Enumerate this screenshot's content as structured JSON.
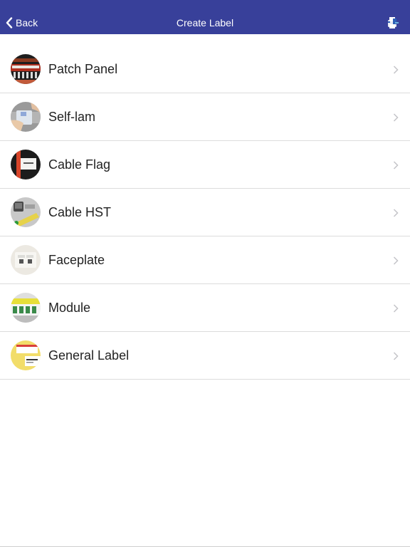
{
  "navbar": {
    "back_label": "Back",
    "title": "Create Label",
    "back_icon": "chevron-left-icon",
    "right_icon": "printer-icon",
    "background": "#38409a"
  },
  "items": [
    {
      "label": "Patch Panel",
      "icon": "patch-panel-thumbnail"
    },
    {
      "label": "Self-lam",
      "icon": "self-lam-thumbnail"
    },
    {
      "label": "Cable Flag",
      "icon": "cable-flag-thumbnail"
    },
    {
      "label": "Cable HST",
      "icon": "cable-hst-thumbnail"
    },
    {
      "label": "Faceplate",
      "icon": "faceplate-thumbnail"
    },
    {
      "label": "Module",
      "icon": "module-thumbnail"
    },
    {
      "label": "General Label",
      "icon": "general-label-thumbnail"
    }
  ],
  "chevron_icon": "chevron-right-icon"
}
